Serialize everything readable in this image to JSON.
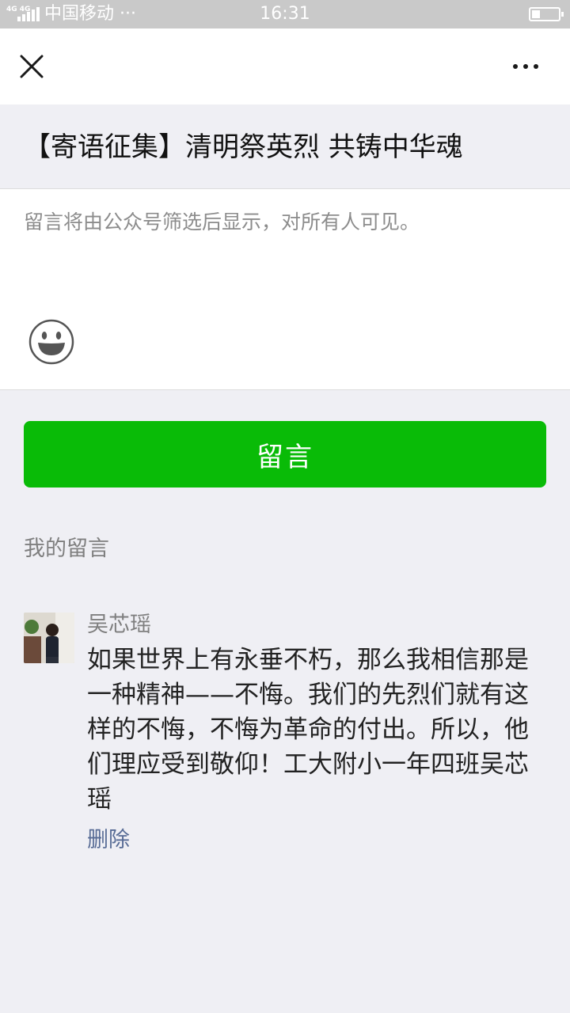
{
  "status_bar": {
    "network_label": "4G 4G",
    "carrier": "中国移动 ···",
    "time": "16:31",
    "battery_level": 0.3
  },
  "nav": {
    "close_icon": "close-icon",
    "more_icon": "more-icon"
  },
  "article": {
    "title": "【寄语征集】清明祭英烈 共铸中华魂"
  },
  "compose": {
    "placeholder": "留言将由公众号筛选后显示，对所有人可见。",
    "value": "",
    "emoji_icon": "emoji-icon"
  },
  "submit": {
    "label": "留言",
    "color": "#09bb07"
  },
  "my_comments": {
    "title": "我的留言",
    "items": [
      {
        "author": "吴芯瑶",
        "text": "如果世界上有永垂不朽，那么我相信那是一种精神——不悔。我们的先烈们就有这样的不悔，不悔为革命的付出。所以，他们理应受到敬仰！工大附小一年四班吴芯瑶",
        "delete_label": "删除"
      }
    ]
  },
  "colors": {
    "page_bg": "#efeff4",
    "link": "#576b95",
    "status_bar_bg": "#c9c9c9"
  }
}
